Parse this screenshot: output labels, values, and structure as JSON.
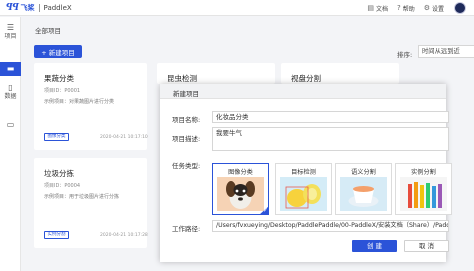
{
  "header": {
    "logo_mark": "飞桨",
    "logo_text": "飞桨",
    "app_name": "PaddleX",
    "nav": [
      {
        "label": "文档",
        "icon": "document-icon"
      },
      {
        "label": "帮助",
        "icon": "help-icon"
      },
      {
        "label": "设置",
        "icon": "gear-icon"
      }
    ]
  },
  "sidebar": {
    "items": [
      {
        "label": "项目",
        "icon": "menu-icon",
        "active": false
      },
      {
        "label": "",
        "icon": "folder-icon",
        "active": true
      },
      {
        "label": "数据",
        "icon": "file-icon",
        "active": false
      },
      {
        "label": "",
        "icon": "monitor-icon",
        "active": false
      }
    ]
  },
  "main": {
    "breadcrumb": "全部项目",
    "new_button": "+ 新建项目",
    "sort_label": "排序:",
    "sort_value": "时间从远到近",
    "cards": [
      {
        "title": "果蔬分类",
        "id": "项目ID：P0001",
        "desc": "示例项目：对果蔬图片进行分类",
        "tag": "图像分类",
        "time": "2020-04-21 10:17:10"
      },
      {
        "title": "垃圾分拣",
        "id": "项目ID：P0004",
        "desc": "示例项目：用于垃圾图片进行分拣",
        "tag": "实例分割",
        "time": "2020-04-21 10:17:28"
      },
      {
        "title": "昆虫检测"
      },
      {
        "title": "视盘分割"
      }
    ]
  },
  "modal": {
    "title": "新建项目",
    "name_label": "项目名称:",
    "name_value": "化妆品分类",
    "desc_label": "项目描述:",
    "desc_value": "我要牛气",
    "task_label": "任务类型:",
    "tasks": [
      {
        "label": "图像分类",
        "selected": true
      },
      {
        "label": "目标检测",
        "selected": false
      },
      {
        "label": "语义分割",
        "selected": false
      },
      {
        "label": "实例分割",
        "selected": false
      }
    ],
    "path_label": "工作路径:",
    "path_value": "/Users/fvxueying/Desktop/PaddlePaddle/00-PaddleX/安装文档（Share）/Paddl",
    "create_button": "创 建",
    "cancel_button": "取 消",
    "accent_color": "#2b53d8"
  }
}
